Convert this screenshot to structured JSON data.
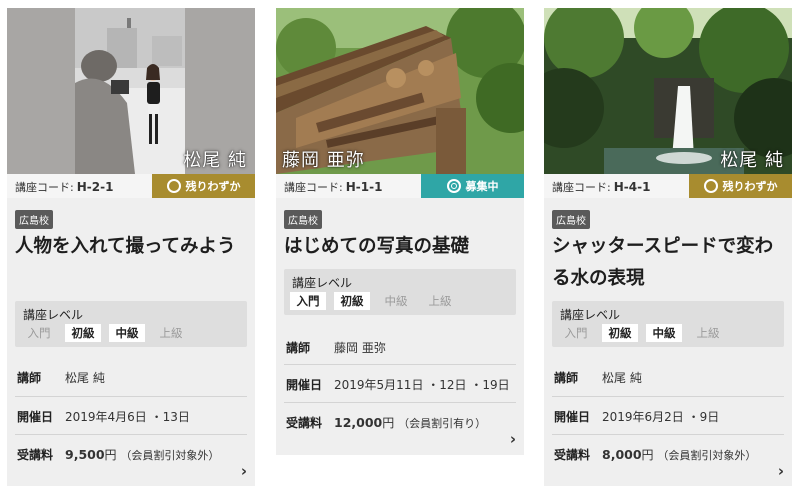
{
  "cards": [
    {
      "teacher_overlay": "松尾 純",
      "code_label": "講座コード:",
      "code": "H-2-1",
      "status": "残りわずか",
      "school": "広島校",
      "title": "人物を入れて撮ってみよう",
      "level_label": "講座レベル",
      "levels": [
        {
          "name": "入門",
          "active": false
        },
        {
          "name": "初級",
          "active": true
        },
        {
          "name": "中級",
          "active": true
        },
        {
          "name": "上級",
          "active": false
        }
      ],
      "instructor_label": "講師",
      "instructor": "松尾 純",
      "date_label": "開催日",
      "date": "2019年4月6日 ・13日",
      "fee_label": "受講料",
      "fee": "9,500",
      "fee_unit": "円",
      "fee_note": "（会員割引対象外）"
    },
    {
      "teacher_overlay": "藤岡 亜弥",
      "code_label": "講座コード:",
      "code": "H-1-1",
      "status": "募集中",
      "school": "広島校",
      "title": "はじめての写真の基礎",
      "level_label": "講座レベル",
      "levels": [
        {
          "name": "入門",
          "active": true
        },
        {
          "name": "初級",
          "active": true
        },
        {
          "name": "中級",
          "active": false
        },
        {
          "name": "上級",
          "active": false
        }
      ],
      "instructor_label": "講師",
      "instructor": "藤岡 亜弥",
      "date_label": "開催日",
      "date": "2019年5月11日 ・12日 ・19日",
      "fee_label": "受講料",
      "fee": "12,000",
      "fee_unit": "円",
      "fee_note": "（会員割引有り）"
    },
    {
      "teacher_overlay": "松尾 純",
      "code_label": "講座コード:",
      "code": "H-4-1",
      "status": "残りわずか",
      "school": "広島校",
      "title": "シャッタースピードで変わる水の表現",
      "level_label": "講座レベル",
      "levels": [
        {
          "name": "入門",
          "active": false
        },
        {
          "name": "初級",
          "active": true
        },
        {
          "name": "中級",
          "active": true
        },
        {
          "name": "上級",
          "active": false
        }
      ],
      "instructor_label": "講師",
      "instructor": "松尾 純",
      "date_label": "開催日",
      "date": "2019年6月2日 ・9日",
      "fee_label": "受講料",
      "fee": "8,000",
      "fee_unit": "円",
      "fee_note": "（会員割引対象外）"
    }
  ],
  "colors": {
    "status_few": "#a88c2f",
    "status_open": "#2fa6a6",
    "card_bg": "#efefef"
  },
  "icons": {
    "status_few": "circle-icon",
    "status_open": "double-circle-icon",
    "more": "chevron-right-icon"
  }
}
